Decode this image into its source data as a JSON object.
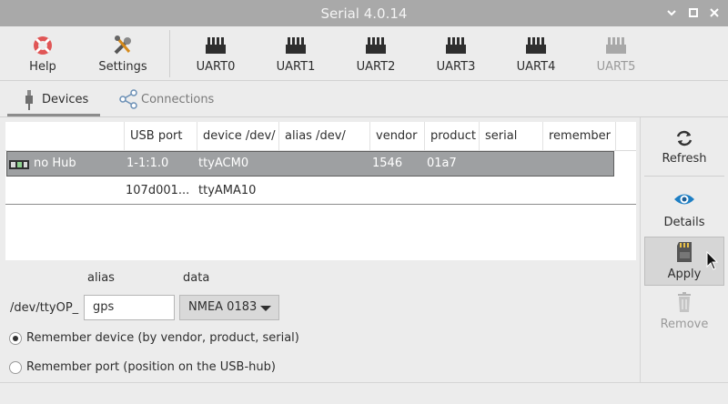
{
  "window": {
    "title": "Serial 4.0.14"
  },
  "toolbar": {
    "items": [
      {
        "label": "Help",
        "icon": "lifebuoy-icon"
      },
      {
        "label": "Settings",
        "icon": "tools-icon"
      },
      {
        "label": "UART0",
        "icon": "connector-icon"
      },
      {
        "label": "UART1",
        "icon": "connector-icon"
      },
      {
        "label": "UART2",
        "icon": "connector-icon"
      },
      {
        "label": "UART3",
        "icon": "connector-icon"
      },
      {
        "label": "UART4",
        "icon": "connector-icon"
      },
      {
        "label": "UART5",
        "icon": "connector-icon",
        "disabled": true
      }
    ]
  },
  "tabs": [
    {
      "label": "Devices",
      "icon": "usb-plug-icon",
      "active": true
    },
    {
      "label": "Connections",
      "icon": "share-nodes-icon",
      "active": false
    }
  ],
  "table": {
    "columns": [
      "",
      "USB port",
      "device /dev/",
      "alias /dev/",
      "vendor",
      "product",
      "serial",
      "remember"
    ],
    "rows": [
      {
        "name": "no Hub",
        "usb_port": "1-1:1.0",
        "device": "ttyACM0",
        "alias": "",
        "vendor": "1546",
        "product": "01a7",
        "serial": "",
        "remember": "",
        "selected": true
      },
      {
        "name": "",
        "usb_port": "107d001...",
        "device": "ttyAMA10",
        "alias": "",
        "vendor": "",
        "product": "",
        "serial": "",
        "remember": "",
        "selected": false
      }
    ]
  },
  "sidebar": {
    "refresh": "Refresh",
    "details": "Details",
    "apply": "Apply",
    "remove": "Remove"
  },
  "form": {
    "alias_label": "alias",
    "data_label": "data",
    "prefix": "/dev/ttyOP_",
    "alias_value": "gps",
    "data_value": "NMEA 0183",
    "radio_device": "Remember device (by vendor, product, serial)",
    "radio_port": "Remember port (position on the USB-hub)",
    "radio_device_checked": true
  },
  "colors": {
    "titlebar": "#a9a9a9",
    "selection": "#9ea0a2",
    "background": "#ececec"
  }
}
